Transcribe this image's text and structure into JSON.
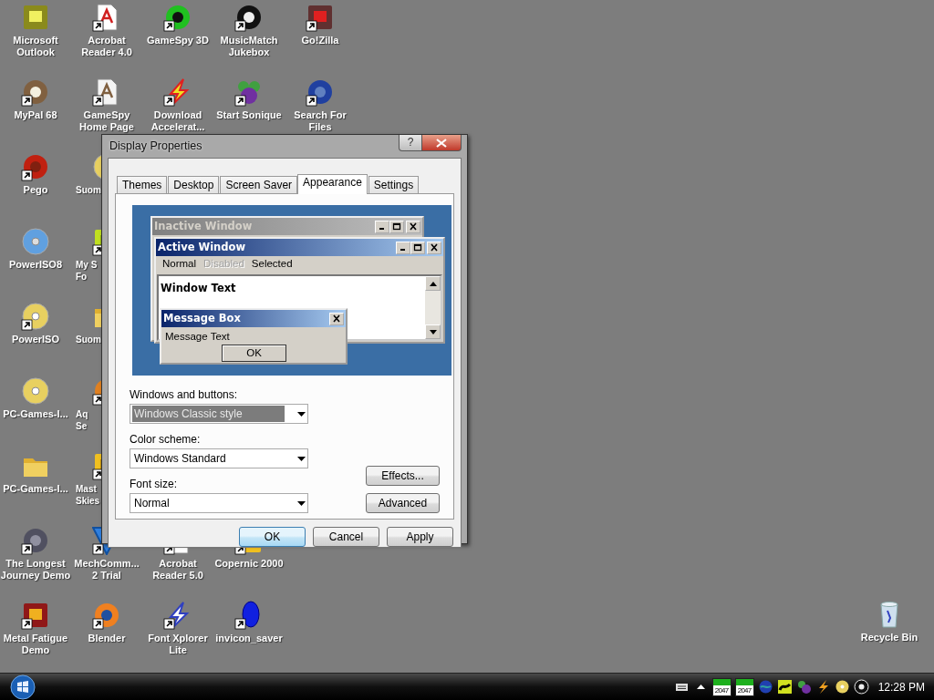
{
  "desktop": {
    "rows": [
      [
        {
          "label": "Microsoft\nOutlook",
          "shortcut": false,
          "cut": false
        },
        {
          "label": "Acrobat\nReader 4.0",
          "shortcut": true,
          "cut": false
        },
        {
          "label": "GameSpy 3D",
          "shortcut": true,
          "cut": false
        },
        {
          "label": "MusicMatch\nJukebox",
          "shortcut": true,
          "cut": false
        },
        {
          "label": "Go!Zilla",
          "shortcut": true,
          "cut": false
        }
      ],
      [
        {
          "label": "MyPal 68",
          "shortcut": true,
          "cut": false
        },
        {
          "label": "GameSpy\nHome Page",
          "shortcut": true,
          "cut": false
        },
        {
          "label": "Download\nAccelerat...",
          "shortcut": true,
          "cut": false
        },
        {
          "label": "Start Sonique",
          "shortcut": true,
          "cut": false
        },
        {
          "label": "Search For\nFiles",
          "shortcut": true,
          "cut": false
        }
      ],
      [
        {
          "label": "Pego",
          "shortcut": true,
          "cut": false
        },
        {
          "label": "Suom",
          "shortcut": false,
          "cut": true
        }
      ],
      [
        {
          "label": "PowerISO8",
          "shortcut": false,
          "cut": false
        },
        {
          "label": "My S\nFo",
          "shortcut": true,
          "cut": true
        }
      ],
      [
        {
          "label": "PowerISO",
          "shortcut": true,
          "cut": false
        },
        {
          "label": "Suom",
          "shortcut": false,
          "cut": true
        }
      ],
      [
        {
          "label": "PC-Games-I...",
          "shortcut": false,
          "cut": false
        },
        {
          "label": "Aq\nSe",
          "shortcut": true,
          "cut": true
        }
      ],
      [
        {
          "label": "PC-Games-I...",
          "shortcut": false,
          "cut": false
        },
        {
          "label": "Mast\nSkies",
          "shortcut": true,
          "cut": true
        }
      ],
      [
        {
          "label": "The Longest\nJourney Demo",
          "shortcut": true,
          "cut": false
        },
        {
          "label": "MechComm...\n2 Trial",
          "shortcut": true,
          "cut": false
        },
        {
          "label": "Acrobat\nReader 5.0",
          "shortcut": true,
          "cut": false
        },
        {
          "label": "Copernic 2000",
          "shortcut": true,
          "cut": false
        }
      ],
      [
        {
          "label": "Metal Fatigue\nDemo",
          "shortcut": true,
          "cut": false
        },
        {
          "label": "Blender",
          "shortcut": true,
          "cut": false
        },
        {
          "label": "Font Xplorer\nLite",
          "shortcut": true,
          "cut": false
        },
        {
          "label": "invicon_saver",
          "shortcut": true,
          "cut": false
        }
      ]
    ],
    "recycle_bin": {
      "label": "Recycle Bin",
      "shortcut": false
    }
  },
  "dialog": {
    "title": "Display Properties",
    "help_button": "?",
    "tabs": [
      {
        "label": "Themes",
        "selected": false
      },
      {
        "label": "Desktop",
        "selected": false
      },
      {
        "label": "Screen Saver",
        "selected": false
      },
      {
        "label": "Appearance",
        "selected": true
      },
      {
        "label": "Settings",
        "selected": false
      }
    ],
    "preview": {
      "inactive_title": "Inactive Window",
      "active_title": "Active Window",
      "menu": [
        {
          "label": "Normal",
          "disabled": false
        },
        {
          "label": "Disabled",
          "disabled": true
        },
        {
          "label": "Selected",
          "disabled": false
        }
      ],
      "window_text": "Window Text",
      "message_box": {
        "title": "Message Box",
        "text": "Message Text",
        "button": "OK"
      }
    },
    "fields": [
      {
        "label": "Windows and buttons:",
        "value": "Windows Classic style",
        "highlighted": true
      },
      {
        "label": "Color scheme:",
        "value": "Windows Standard",
        "highlighted": false
      },
      {
        "label": "Font size:",
        "value": "Normal",
        "highlighted": false
      }
    ],
    "side_buttons": [
      "Effects...",
      "Advanced"
    ],
    "buttons": [
      {
        "label": "OK",
        "default": true
      },
      {
        "label": "Cancel",
        "default": false
      },
      {
        "label": "Apply",
        "default": false
      }
    ]
  },
  "taskbar": {
    "meters": [
      {
        "text": "2047"
      },
      {
        "text": "2047"
      }
    ],
    "clock": "12:28 PM"
  }
}
